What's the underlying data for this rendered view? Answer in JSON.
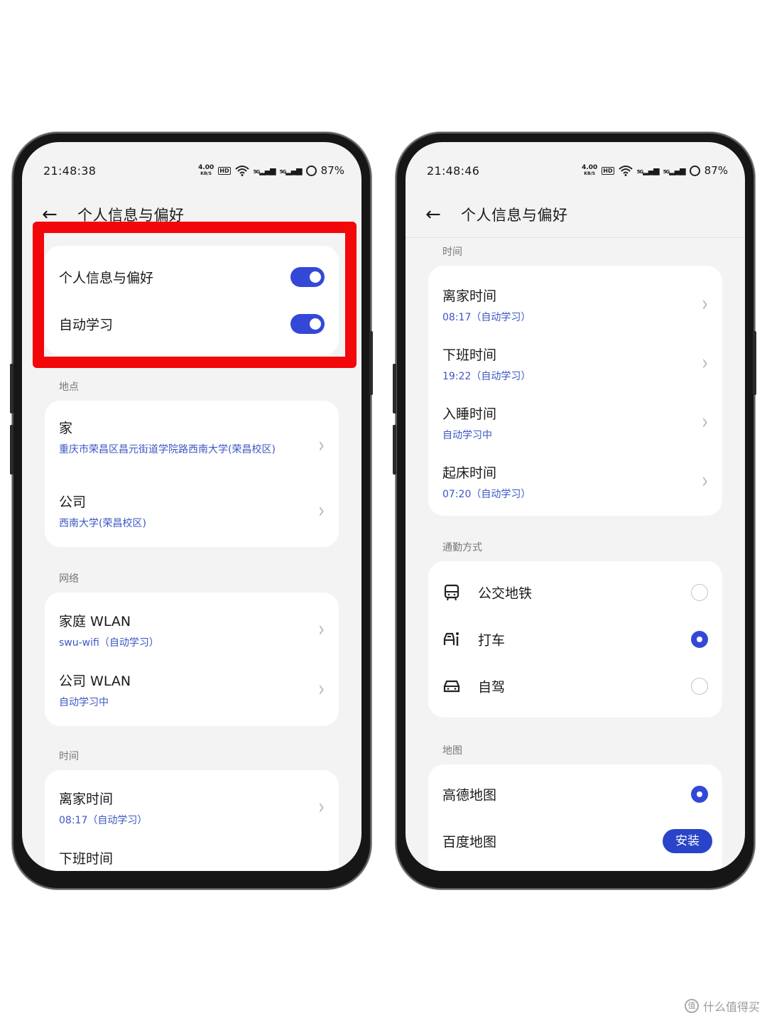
{
  "left": {
    "status": {
      "time": "21:48:38",
      "speed_value": "4.00",
      "speed_unit": "KB/S",
      "hd": "HD",
      "sig_a": "5G",
      "sig_b": "5G",
      "battery": "87%"
    },
    "header": {
      "title": "个人信息与偏好"
    },
    "toggles": [
      {
        "label": "个人信息与偏好",
        "on": true
      },
      {
        "label": "自动学习",
        "on": true
      }
    ],
    "location_section": "地点",
    "locations": [
      {
        "title": "家",
        "sub": "重庆市荣昌区昌元街道学院路西南大学(荣昌校区)"
      },
      {
        "title": "公司",
        "sub": "西南大学(荣昌校区)"
      }
    ],
    "network_section": "网络",
    "networks": [
      {
        "title": "家庭 WLAN",
        "sub": "swu-wifi（自动学习）"
      },
      {
        "title": "公司 WLAN",
        "sub": "自动学习中"
      }
    ],
    "time_section": "时间",
    "times": [
      {
        "title": "离家时间",
        "sub": "08:17（自动学习）"
      },
      {
        "title": "下班时间",
        "sub": ""
      }
    ]
  },
  "right": {
    "status": {
      "time": "21:48:46",
      "speed_value": "4.00",
      "speed_unit": "KB/S",
      "hd": "HD",
      "sig_a": "5G",
      "sig_b": "5G",
      "battery": "87%"
    },
    "header": {
      "title": "个人信息与偏好"
    },
    "time_section": "时间",
    "times": [
      {
        "title": "离家时间",
        "sub": "08:17（自动学习）"
      },
      {
        "title": "下班时间",
        "sub": "19:22（自动学习）"
      },
      {
        "title": "入睡时间",
        "sub": "自动学习中"
      },
      {
        "title": "起床时间",
        "sub": "07:20（自动学习）"
      }
    ],
    "commute_section": "通勤方式",
    "commutes": [
      {
        "label": "公交地铁",
        "icon": "bus-icon",
        "selected": false
      },
      {
        "label": "打车",
        "icon": "taxi-icon",
        "selected": true
      },
      {
        "label": "自驾",
        "icon": "car-icon",
        "selected": false
      }
    ],
    "map_section": "地图",
    "maps": [
      {
        "label": "高德地图",
        "selected": true
      },
      {
        "label": "百度地图",
        "action": "安装"
      }
    ]
  },
  "watermark": {
    "logo": "值",
    "text": "什么值得买"
  },
  "colors": {
    "accent": "#3448d8",
    "link": "#3b57c4",
    "highlight": "#f2070b"
  }
}
